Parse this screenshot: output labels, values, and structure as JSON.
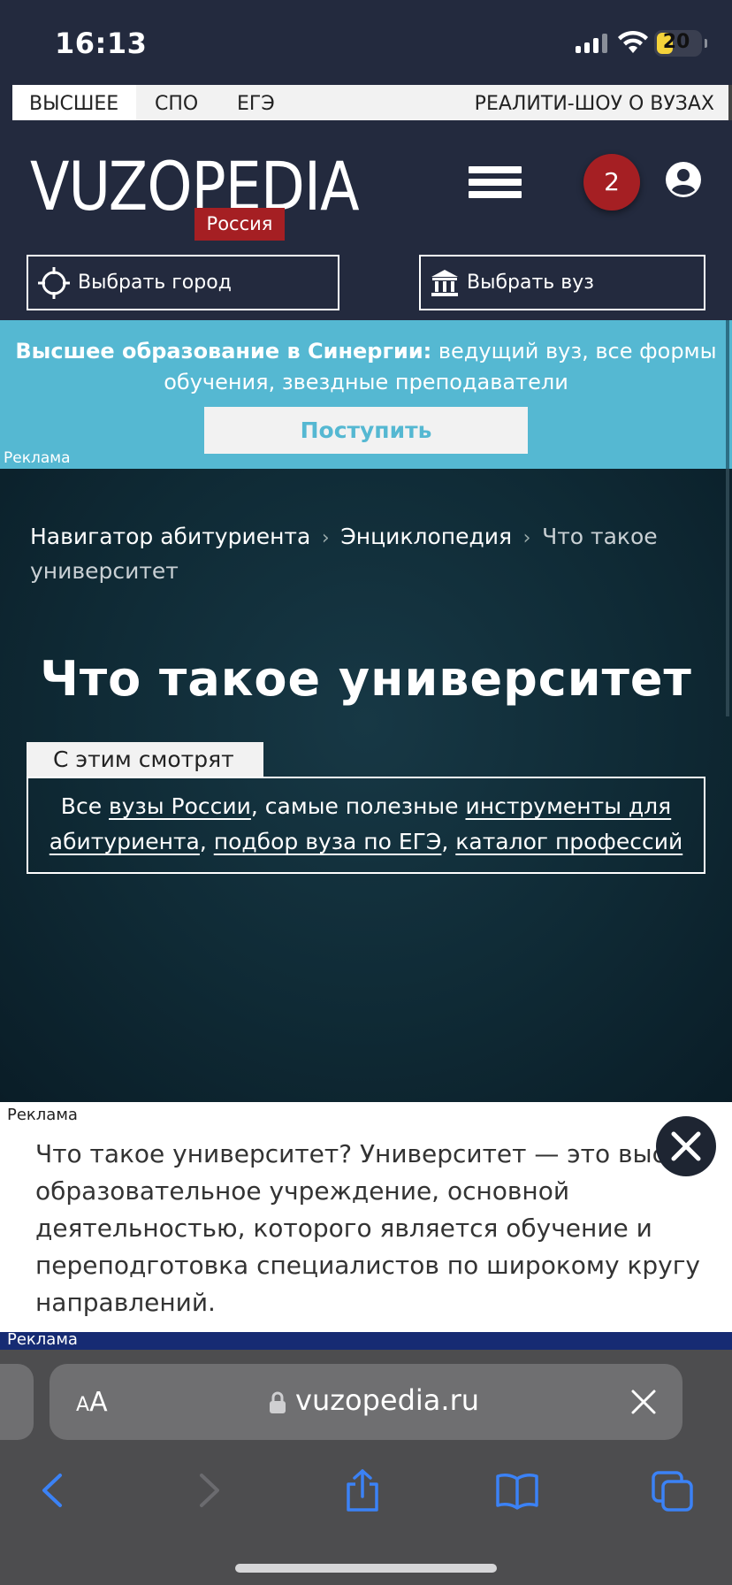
{
  "status_bar": {
    "time": "16:13",
    "battery": "20"
  },
  "top_nav": {
    "tabs": [
      "ВЫСШЕЕ",
      "СПО",
      "ЕГЭ"
    ],
    "right_link": "РЕАЛИТИ-ШОУ О ВУЗАХ"
  },
  "header": {
    "logo_text": "VUZOPEDIA",
    "logo_badge": "Россия",
    "notifications_count": "2",
    "choose_city": "Выбрать город",
    "choose_university": "Выбрать вуз"
  },
  "ad_banner": {
    "bold_text": "Высшее образование в Синергии:",
    "text": " ведущий вуз, все формы обучения, звездные преподаватели",
    "cta": "Поступить",
    "label": "Реклама",
    "bg_color": "#55b8d2"
  },
  "breadcrumbs": {
    "items": [
      "Навигатор абитуриента",
      "Энциклопедия"
    ],
    "current": "Что такое университет",
    "separator": "›"
  },
  "page_title": "Что такое университет",
  "see_also": {
    "tab_label": "С этим смотрят",
    "prefix": "Все ",
    "link1": "вузы России",
    "mid1": ", самые полезные ",
    "link2a": "инструменты для",
    "link2b": "абитуриента",
    "sep": ", ",
    "link3": "подбор вуза по ЕГЭ",
    "link4": "каталог профессий"
  },
  "article": {
    "ad_label": "Реклама",
    "lines": [
      "Что такое университет? Университет — это высше",
      "образовательное учреждение, основной",
      "деятельностью, которого является обучение и",
      "переподготовка специалистов по широкому кругу",
      "направлений."
    ],
    "second_ad_label": "Реклама"
  },
  "browser": {
    "text_size_label": "AA",
    "url": "vuzopedia.ru",
    "toolbar_icons": [
      "back-icon",
      "forward-icon",
      "share-icon",
      "bookmarks-icon",
      "tabs-icon"
    ]
  },
  "colors": {
    "header_bg": "#232a3e",
    "accent_red": "#a51f23",
    "hero_bg": "#0f2a35",
    "ios_blue": "#3b82f6"
  }
}
